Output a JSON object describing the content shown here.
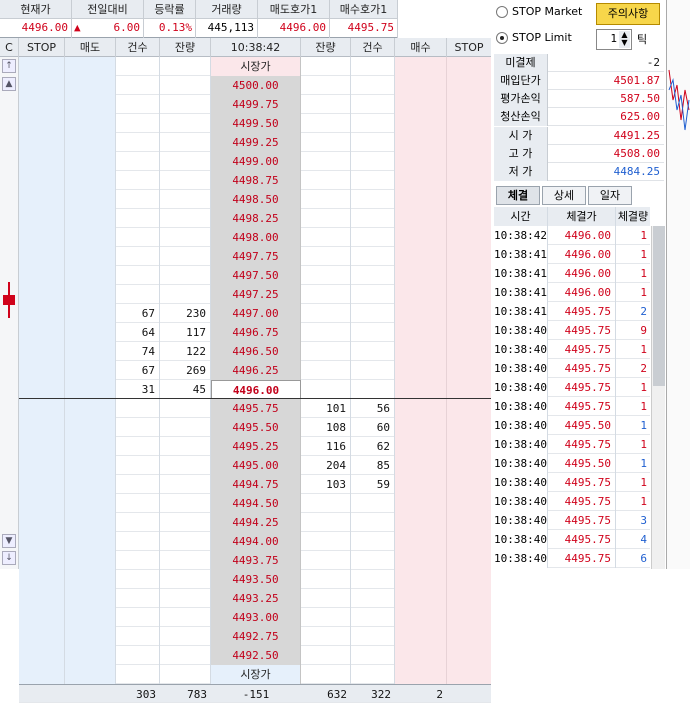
{
  "quote": {
    "headers": [
      "현재가",
      "전일대비",
      "등락률",
      "거래량",
      "매도호가1",
      "매수호가1"
    ],
    "current_price": "4496.00",
    "change_arrow": "▲",
    "change": "6.00",
    "change_rate": "0.13%",
    "volume": "445,113",
    "ask1": "4496.00",
    "bid1": "4495.75"
  },
  "orderbook": {
    "headers": [
      "C",
      "STOP",
      "매도",
      "건수",
      "잔량",
      "10:38:42",
      "잔량",
      "건수",
      "매수",
      "STOP"
    ],
    "market_top": "시장가",
    "market_bottom": "시장가",
    "asks": [
      {
        "price": "4500.00"
      },
      {
        "price": "4499.75"
      },
      {
        "price": "4499.50"
      },
      {
        "price": "4499.25"
      },
      {
        "price": "4499.00"
      },
      {
        "price": "4498.75"
      },
      {
        "price": "4498.50"
      },
      {
        "price": "4498.25"
      },
      {
        "price": "4498.00"
      },
      {
        "price": "4497.75"
      },
      {
        "price": "4497.50"
      },
      {
        "price": "4497.25"
      },
      {
        "price": "4497.00",
        "cnt": "67",
        "rem": "230"
      },
      {
        "price": "4496.75",
        "cnt": "64",
        "rem": "117"
      },
      {
        "price": "4496.50",
        "cnt": "74",
        "rem": "122"
      },
      {
        "price": "4496.25",
        "cnt": "67",
        "rem": "269"
      },
      {
        "price": "4496.00",
        "cnt": "31",
        "rem": "45"
      }
    ],
    "bids": [
      {
        "price": "4495.75",
        "rem": "101",
        "cnt": "56"
      },
      {
        "price": "4495.50",
        "rem": "108",
        "cnt": "60"
      },
      {
        "price": "4495.25",
        "rem": "116",
        "cnt": "62"
      },
      {
        "price": "4495.00",
        "rem": "204",
        "cnt": "85"
      },
      {
        "price": "4494.75",
        "rem": "103",
        "cnt": "59"
      },
      {
        "price": "4494.50"
      },
      {
        "price": "4494.25"
      },
      {
        "price": "4494.00"
      },
      {
        "price": "4493.75"
      },
      {
        "price": "4493.50"
      },
      {
        "price": "4493.25"
      },
      {
        "price": "4493.00"
      },
      {
        "price": "4492.75"
      },
      {
        "price": "4492.50"
      }
    ],
    "totals": {
      "ask_cnt": "303",
      "ask_rem": "783",
      "diff": "-151",
      "bid_rem": "632",
      "bid_cnt": "322",
      "bid_stop": "2"
    }
  },
  "panel": {
    "stop_market": "STOP Market",
    "caution": "주의사항",
    "stop_limit": "STOP Limit",
    "tick_value": "1",
    "tick_label": "틱",
    "rows": [
      {
        "label": "미결제",
        "value": "-2"
      },
      {
        "label": "매입단가",
        "value": "4501.87"
      },
      {
        "label": "평가손익",
        "value": "587.50"
      },
      {
        "label": "청산손익",
        "value": "625.00"
      },
      {
        "label": "시 가",
        "value": "4491.25"
      },
      {
        "label": "고 가",
        "value": "4508.00"
      },
      {
        "label": "저 가",
        "value": "4484.25"
      }
    ],
    "tabs": [
      "체결",
      "상세",
      "일자"
    ],
    "trade_headers": [
      "시간",
      "체결가",
      "체결량"
    ],
    "trades": [
      {
        "t": "10:38:42",
        "p": "4496.00",
        "q": "1",
        "c": "red"
      },
      {
        "t": "10:38:41",
        "p": "4496.00",
        "q": "1",
        "c": "red"
      },
      {
        "t": "10:38:41",
        "p": "4496.00",
        "q": "1",
        "c": "red"
      },
      {
        "t": "10:38:41",
        "p": "4496.00",
        "q": "1",
        "c": "red"
      },
      {
        "t": "10:38:41",
        "p": "4495.75",
        "q": "2",
        "c": "blue"
      },
      {
        "t": "10:38:40",
        "p": "4495.75",
        "q": "9",
        "c": "red"
      },
      {
        "t": "10:38:40",
        "p": "4495.75",
        "q": "1",
        "c": "red"
      },
      {
        "t": "10:38:40",
        "p": "4495.75",
        "q": "2",
        "c": "red"
      },
      {
        "t": "10:38:40",
        "p": "4495.75",
        "q": "1",
        "c": "red"
      },
      {
        "t": "10:38:40",
        "p": "4495.75",
        "q": "1",
        "c": "red"
      },
      {
        "t": "10:38:40",
        "p": "4495.50",
        "q": "1",
        "c": "blue"
      },
      {
        "t": "10:38:40",
        "p": "4495.75",
        "q": "1",
        "c": "red"
      },
      {
        "t": "10:38:40",
        "p": "4495.50",
        "q": "1",
        "c": "blue"
      },
      {
        "t": "10:38:40",
        "p": "4495.75",
        "q": "1",
        "c": "red"
      },
      {
        "t": "10:38:40",
        "p": "4495.75",
        "q": "1",
        "c": "red"
      },
      {
        "t": "10:38:40",
        "p": "4495.75",
        "q": "3",
        "c": "blue"
      },
      {
        "t": "10:38:40",
        "p": "4495.75",
        "q": "4",
        "c": "blue"
      },
      {
        "t": "10:38:40",
        "p": "4495.75",
        "q": "6",
        "c": "blue"
      }
    ]
  },
  "colors": {
    "ask_bg": "#e6f0fb",
    "bid_bg": "#fbe7ea",
    "price_bg": "#d7d7d7",
    "up": "#d0021b",
    "down": "#1f5fd0",
    "caution_bg": "#f7d64a"
  }
}
